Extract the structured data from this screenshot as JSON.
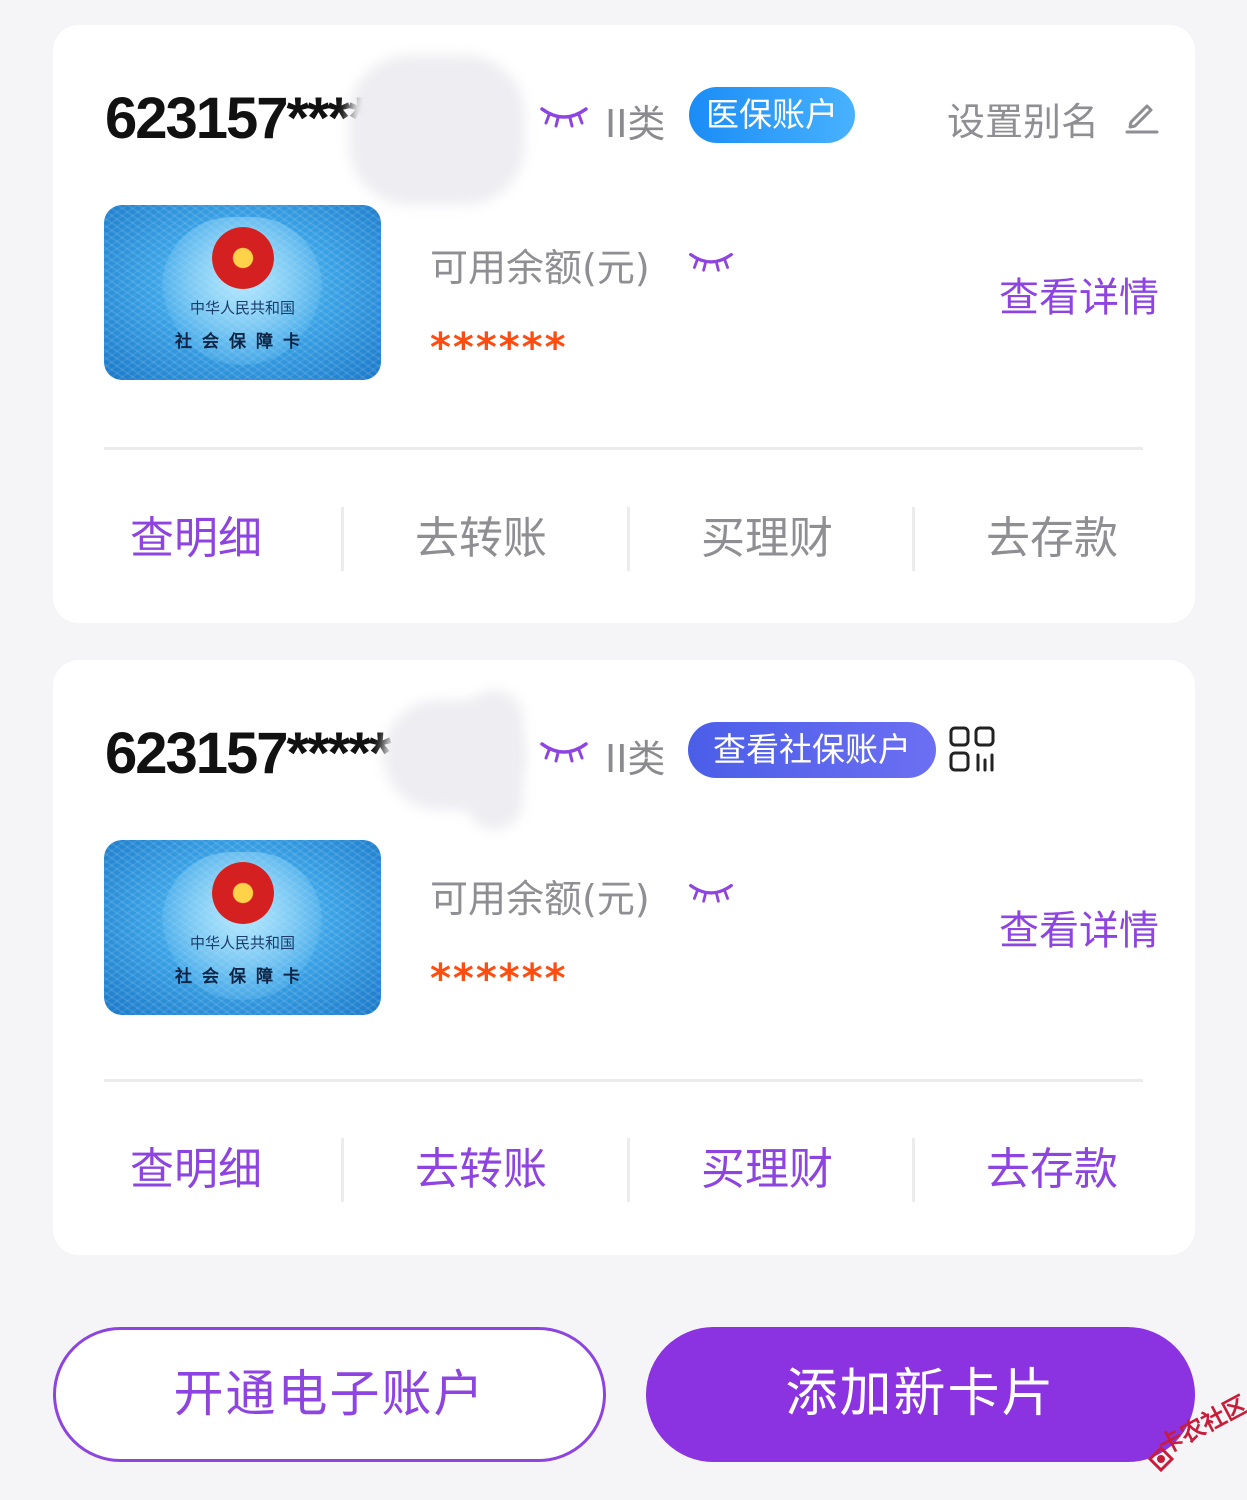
{
  "accounts": [
    {
      "number_masked": "623157****",
      "class_label": "II类",
      "tag": "医保账户",
      "alias_label": "设置别名",
      "balance_label": "可用余额(元)",
      "balance_value": "******",
      "detail_label": "查看详情",
      "actions": [
        "查明细",
        "去转账",
        "买理财",
        "去存款"
      ],
      "card_text_line1": "中华人民共和国",
      "card_text_line2": "社会保障卡"
    },
    {
      "number_masked": "623157*****",
      "number_tail_partial": "62",
      "class_label": "II类",
      "tag": "查看社保账户",
      "balance_label": "可用余额(元)",
      "balance_value": "******",
      "detail_label": "查看详情",
      "actions": [
        "查明细",
        "去转账",
        "买理财",
        "去存款"
      ],
      "card_text_line1": "中华人民共和国",
      "card_text_line2": "社会保障卡"
    }
  ],
  "buttons": {
    "open_e_account": "开通电子账户",
    "add_new_card": "添加新卡片"
  },
  "watermark": {
    "text": "卡农社区"
  },
  "icons": {
    "eye": "eye-closed-icon",
    "pencil": "pencil-icon",
    "qr": "qr-code-icon"
  },
  "colors": {
    "accent_purple": "#8e44e0",
    "primary_button": "#8b33e0",
    "balance_orange": "#ff4d12",
    "tag_blue": "#1a8cf5",
    "tag_indigo": "#4b5ee8"
  }
}
